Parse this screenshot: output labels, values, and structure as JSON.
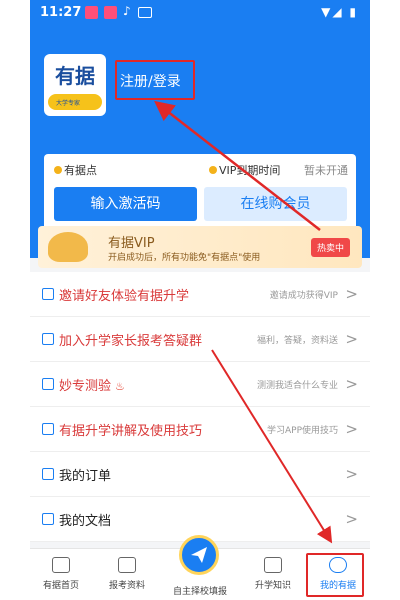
{
  "status_bar": {
    "time": "11:27",
    "right_icons": "▼◢ ▮"
  },
  "header": {
    "logo_text": "有据",
    "logo_sub": "大学专家",
    "login_text": "注册/登录"
  },
  "card": {
    "label_points": "有据点",
    "label_vip_expire": "VIP到期时间",
    "vip_status": "暂未开通",
    "btn_activate": "输入激活码",
    "btn_buy": "在线购会员"
  },
  "promo": {
    "title": "有据VIP",
    "subtitle": "开启成功后，所有功能免\"有据点\"使用",
    "badge": "热卖中"
  },
  "menu": [
    {
      "label": "邀请好友体验有据升学",
      "hint": "邀请成功获得VIP",
      "red": true
    },
    {
      "label": "加入升学家长报考答疑群",
      "hint": "福利，答疑，资料送",
      "red": true
    },
    {
      "label": "妙专测验",
      "hint": "测测我适合什么专业",
      "red": true,
      "fire": "♨"
    },
    {
      "label": "有据升学讲解及使用技巧",
      "hint": "学习APP使用技巧",
      "red": true
    },
    {
      "label": "我的订单",
      "hint": "",
      "red": false
    },
    {
      "label": "我的文档",
      "hint": "",
      "red": false
    }
  ],
  "tabs": [
    {
      "label": "有据首页",
      "icon": "home-icon"
    },
    {
      "label": "报考资料",
      "icon": "document-icon"
    },
    {
      "label": "自主择校填报",
      "icon": "paper-plane-icon"
    },
    {
      "label": "升学知识",
      "icon": "graduation-cap-icon"
    },
    {
      "label": "我的有据",
      "icon": "profile-icon"
    }
  ],
  "colors": {
    "primary": "#1a7ef2",
    "annotation": "#e02828",
    "menu_red": "#d93a3a"
  }
}
